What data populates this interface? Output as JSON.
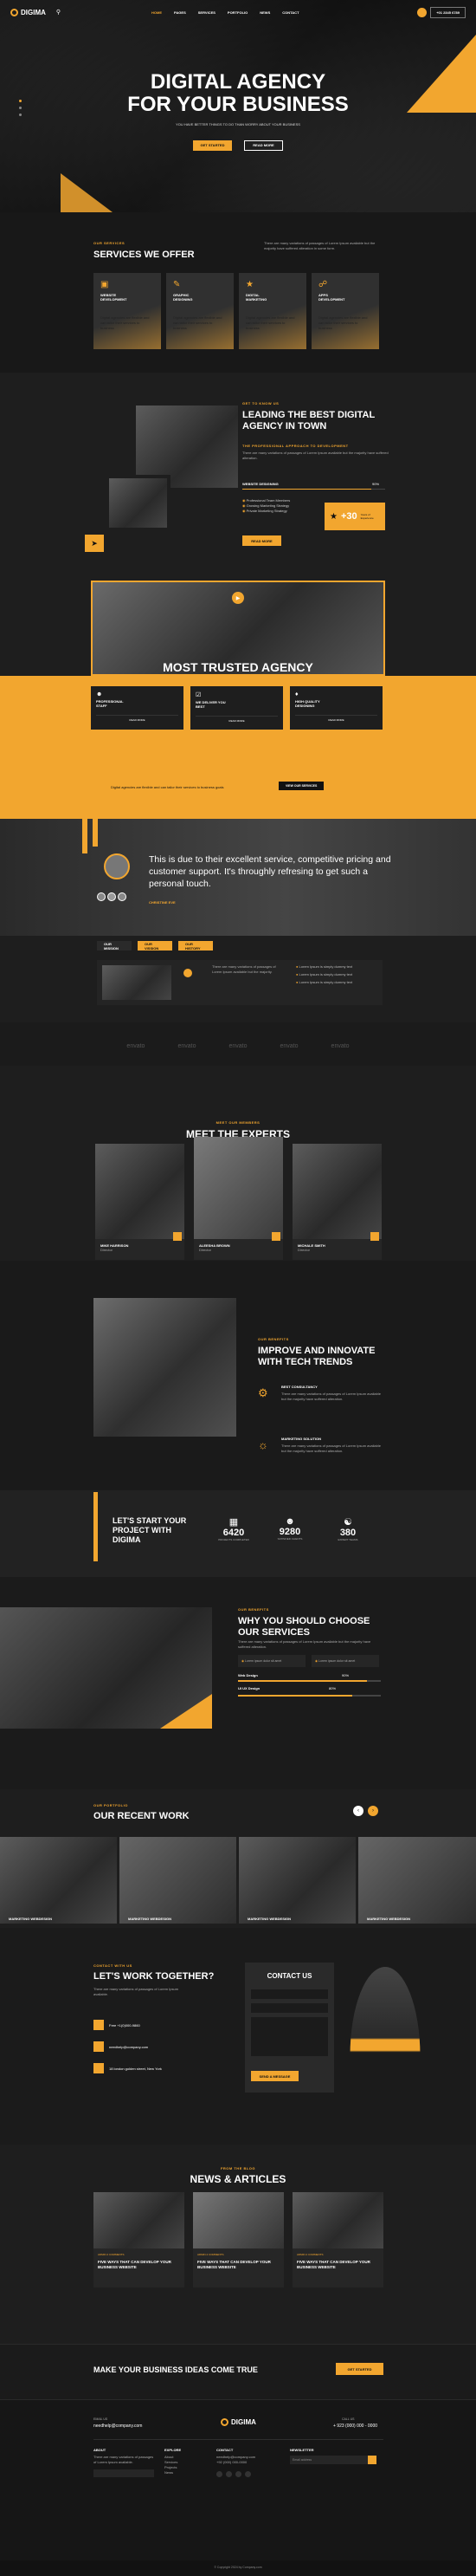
{
  "header": {
    "logo": "DIGIMA",
    "nav": [
      "HOME",
      "PAGES",
      "SERVICES",
      "PORTFOLIO",
      "NEWS",
      "CONTACT"
    ],
    "phone": "+01 2345 6789",
    "colors": {
      "accent": "#f2a62f",
      "bg": "#1b1b1b"
    }
  },
  "hero": {
    "title_1": "DIGITAL AGENCY",
    "title_2": "FOR YOUR BUSINESS",
    "subtitle": "YOU HAVE BETTER THINGS TO DO THAN WORRY ABOUT YOUR BUSINESS",
    "btn_primary": "GET STARTED",
    "btn_secondary": "READ MORE"
  },
  "services": {
    "label": "OUR SERVICES",
    "title": "SERVICES WE OFFER",
    "intro": "There are many variations of passages of Lorem Ipsum available but the majority have suffered alteration in some form.",
    "items": [
      {
        "title": "WEBSITE DEVELOPMENT",
        "text": "Digital agencies are flexible and can tailor their services to business"
      },
      {
        "title": "GRAPHIC DESIGNING",
        "text": "Digital agencies are flexible and can tailor their services to business"
      },
      {
        "title": "DIGITAL MARKETING",
        "text": "Digital agencies are flexible and can tailor their services to business"
      },
      {
        "title": "APPS DEVELOPMENT",
        "text": "Digital agencies are flexible and can tailor their services to business"
      }
    ]
  },
  "about": {
    "label": "GET TO KNOW US",
    "title": "LEADING THE BEST DIGITAL AGENCY IN TOWN",
    "sub": "THE PROFESSIONAL APPROACH TO DEVELOPMENT",
    "text": "There are many variations of passages of Lorem Ipsum available but the majority have suffered alteration.",
    "skill": "WEBSITE DESIGNING",
    "skill_pct": "90%",
    "skill_value": 0.9,
    "checks": [
      "Professional Team Members",
      "Growing Marketing Strategy",
      "Private Marketing Strategy"
    ],
    "btn": "READ MORE",
    "badge_value": "+30",
    "badge_text": "Years of Experience"
  },
  "trusted": {
    "title": "MOST TRUSTED AGENCY",
    "cards": [
      {
        "title": "PROFESSIONAL STAFF",
        "link": "READ MORE"
      },
      {
        "title": "WE DELIVER YOU BEST",
        "link": "READ MORE"
      },
      {
        "title": "HIGH QUALITY DESIGNING",
        "link": "READ MORE"
      }
    ],
    "note": "Digital agencies are flexible and can tailor their services to business goals",
    "note_btn": "VIEW OUR SERVICES"
  },
  "testimonial": {
    "quote": "This is due to their excellent service, competitive pricing and customer support. It's throughly refresing to get such a personal touch.",
    "name": "CHRISTINE EVE",
    "tabs": [
      "OUR MISSION",
      "OUR VISSION",
      "OUR HISTORY"
    ],
    "text": "There are many variations of passages of Lorem Ipsum available but the majority.",
    "list": [
      "Lorem Ipsum is simply dummy text",
      "Lorem Ipsum is simply dummy text",
      "Lorem Ipsum is simply dummy text"
    ],
    "list2": [
      "Lorem Ipsum is simply dummy text",
      "Lorem Ipsum is simply dummy text",
      "Lorem Ipsum is simply dummy text"
    ]
  },
  "partners": [
    "envato",
    "envato",
    "envato",
    "envato",
    "envato"
  ],
  "team": {
    "label": "MEET OUR MEMBERS",
    "title": "MEET THE EXPERTS",
    "members": [
      {
        "name": "MIKE HARRISON",
        "role": "Director"
      },
      {
        "name": "ALEESHA BROWN",
        "role": "Director"
      },
      {
        "name": "MICHALE SMITH",
        "role": "Director"
      }
    ]
  },
  "innovate": {
    "label": "OUR BENEFITS",
    "title": "IMPROVE AND INNOVATE WITH TECH TRENDS",
    "items": [
      {
        "title": "BEST CONSULTANCY",
        "text": "There are many variations of passages of Lorem Ipsum available but the majority have suffered alteration."
      },
      {
        "title": "MARKETING SOLUTION",
        "text": "There are many variations of passages of Lorem Ipsum available but the majority have suffered alteration."
      }
    ]
  },
  "stats": {
    "title": "LET'S START YOUR PROJECT WITH DIGIMA",
    "items": [
      {
        "value": "6420",
        "label": "PROJECTS COMPLETED"
      },
      {
        "value": "9280",
        "label": "SATISFIED CLIENTS"
      },
      {
        "value": "380",
        "label": "EXPERT TEAMS"
      }
    ]
  },
  "why": {
    "label": "OUR BENEFITS",
    "title": "WHY YOU SHOULD CHOOSE OUR SERVICES",
    "text": "There are many variations of passages of Lorem Ipsum available but the majority have suffered alteration.",
    "boxes": [
      "Lorem ipsum dolor sit amet",
      "Lorem ipsum dolor sit amet"
    ],
    "skills": [
      {
        "name": "Web Design",
        "pct": "90%",
        "value": 0.9
      },
      {
        "name": "UI UX Design",
        "pct": "80%",
        "value": 0.8
      }
    ]
  },
  "work": {
    "label": "OUR PORTFOLIO",
    "title": "OUR RECENT WORK",
    "items": [
      "MARKETING WEBDESIGN",
      "MARKETING WEBDESIGN",
      "MARKETING WEBDESIGN",
      "MARKETING WEBDESIGN"
    ]
  },
  "contact": {
    "label": "CONTACT WITH US",
    "title": "LET'S WORK TOGETHER?",
    "text": "There are many variations of passages of Lorem Ipsum available.",
    "phone": "Free +1(0)000-9860",
    "email": "needhelp@company.com",
    "address": "18 london golden street, New York",
    "form_title": "CONTACT US",
    "form_btn": "SEND A MESSAGE"
  },
  "news": {
    "label": "FROM THE BLOG",
    "title": "NEWS & ARTICLES",
    "items": [
      {
        "meta": "ADMIN  2 COMMENTS",
        "title": "FIVE WAYS THAT CAN DEVELOP YOUR BUSINESS WEBSITE"
      },
      {
        "meta": "ADMIN  2 COMMENTS",
        "title": "FIVE WAYS THAT CAN DEVELOP YOUR BUSINESS WEBSITE"
      },
      {
        "meta": "ADMIN  2 COMMENTS",
        "title": "FIVE WAYS THAT CAN DEVELOP YOUR BUSINESS WEBSITE"
      }
    ]
  },
  "cta": {
    "title": "MAKE YOUR BUSINESS IDEAS COME TRUE",
    "btn": "GET STARTED"
  },
  "footer": {
    "email_label": "EMAIL US",
    "email": "needhelp@company.com",
    "logo": "DIGIMA",
    "call_label": "CALL US",
    "call": "+ 923 (000) 000 - 0000",
    "cols": [
      "ABOUT",
      "EXPLORE",
      "CONTACT",
      "NEWSLETTER"
    ],
    "about": "There are many variations of passages of Lorem Ipsum available.",
    "explore": [
      "About",
      "Services",
      "Projects",
      "News"
    ],
    "contact": [
      "needhelp@company.com",
      "+92 (000) 000-0000"
    ],
    "newsletter": "Email address",
    "copy": "© Copyright 2024 by Company.com"
  }
}
